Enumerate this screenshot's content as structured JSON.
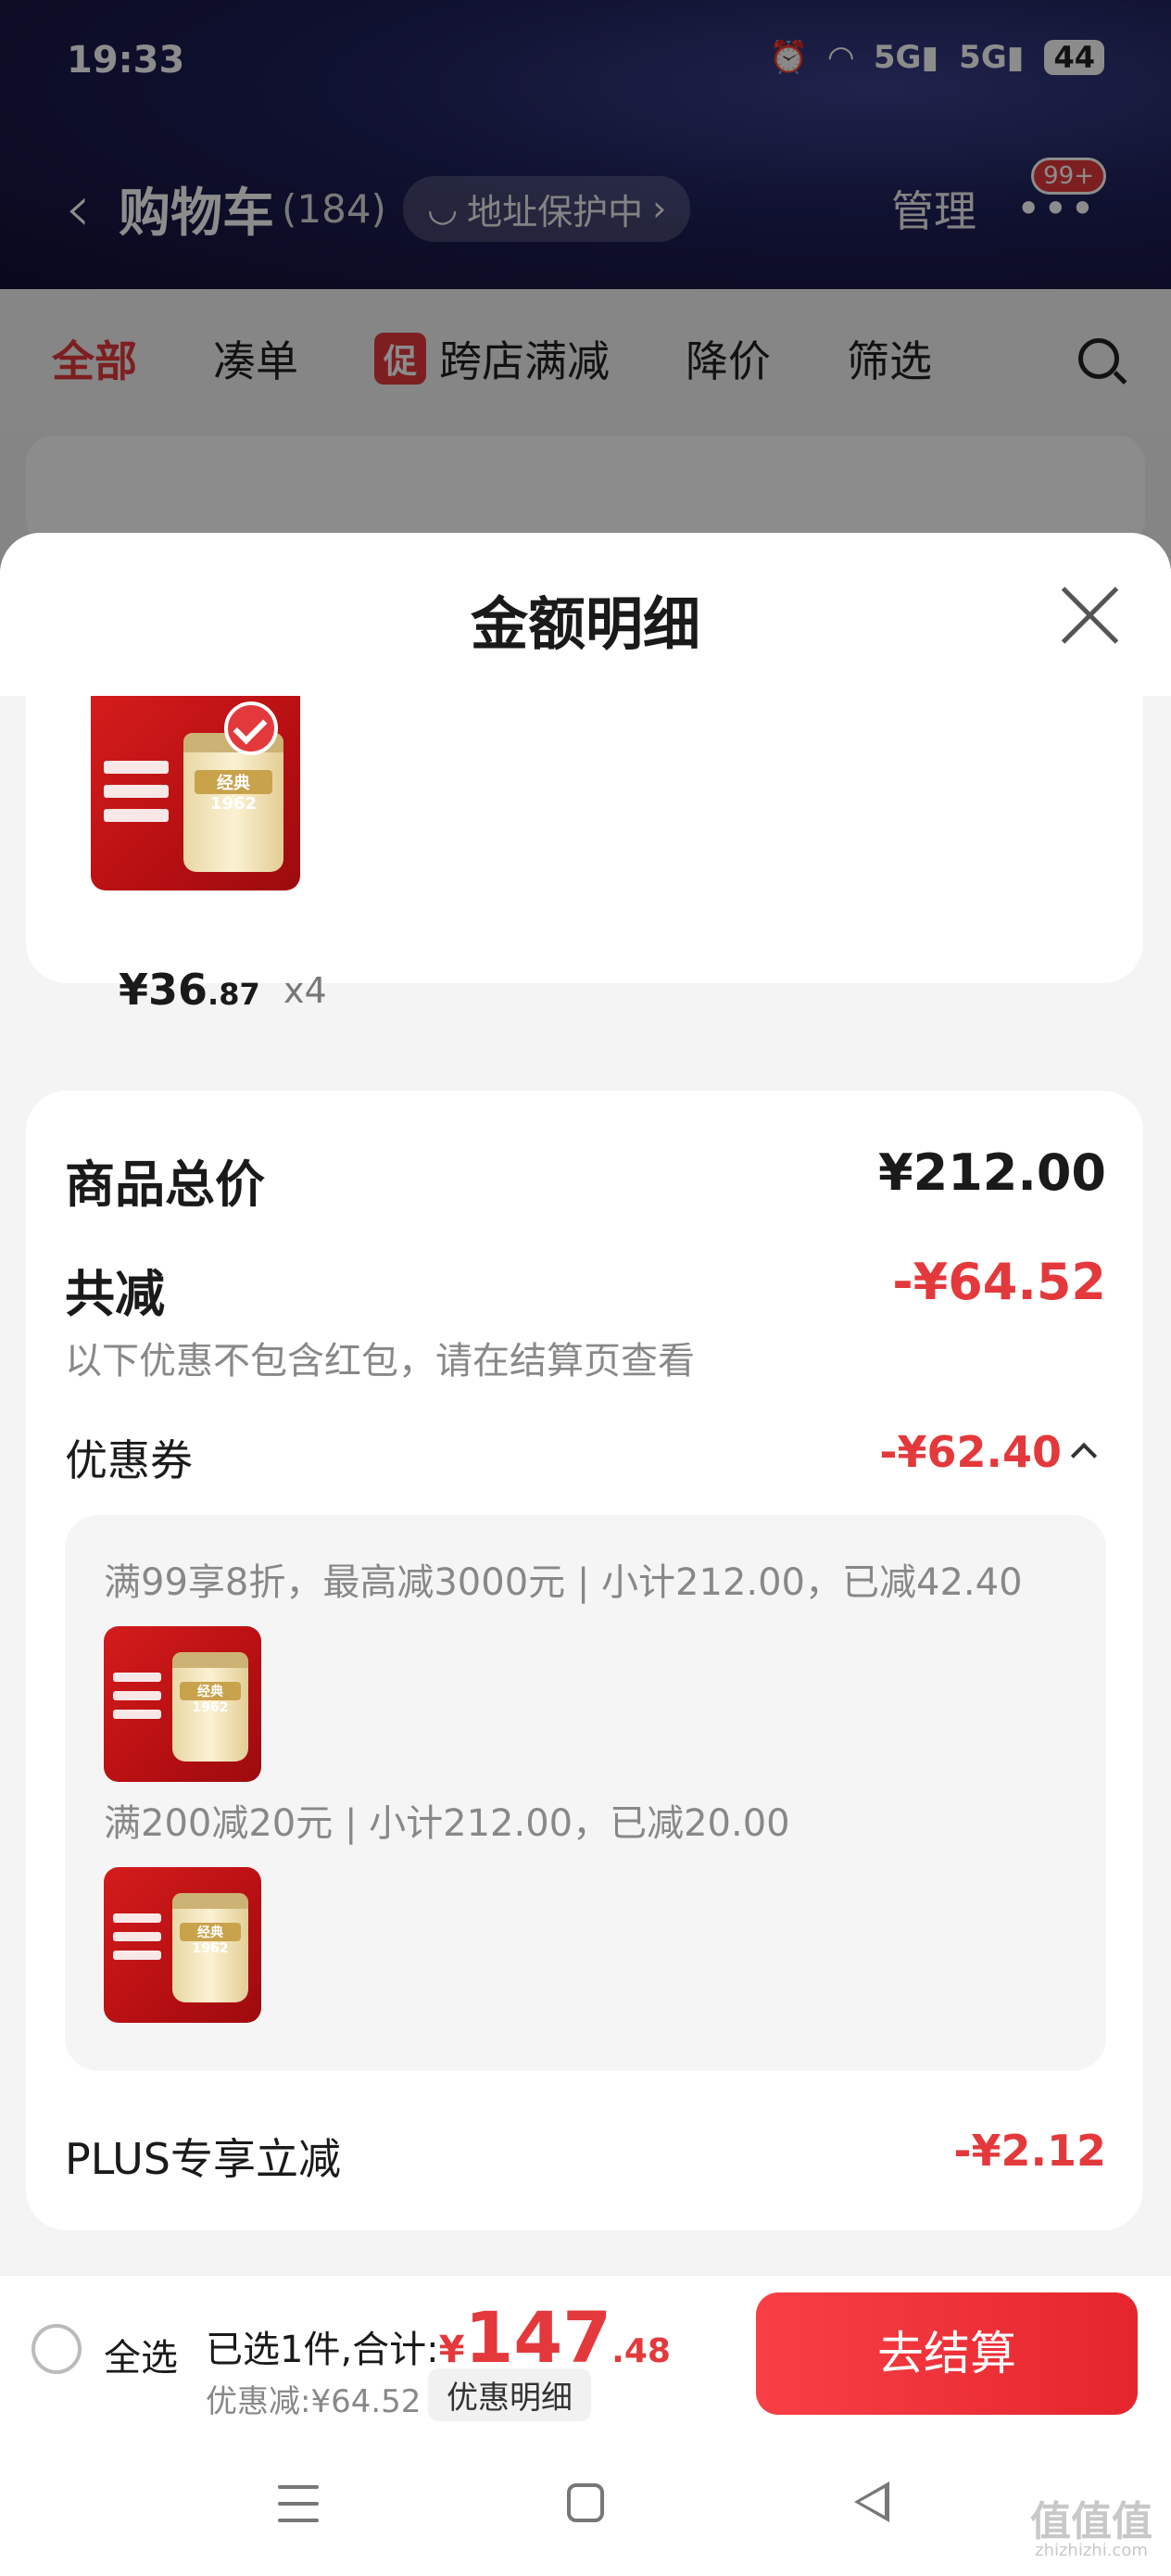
{
  "status_bar": {
    "time": "19:33",
    "net1": "5G",
    "net2": "5G",
    "battery": "44"
  },
  "header": {
    "title": "购物车",
    "count": "(184)",
    "address_protection": "地址保护中",
    "manage": "管理",
    "badge": "99+"
  },
  "filters": [
    {
      "label": "全部",
      "active": true
    },
    {
      "label": "凑单"
    },
    {
      "label": "跨店满减",
      "tag": "促"
    },
    {
      "label": "降价"
    },
    {
      "label": "筛选"
    }
  ],
  "sheet": {
    "title": "金额明细",
    "product": {
      "price_int": "¥36",
      "price_dec": ".87",
      "qty": "x4",
      "brand": "经典1962"
    },
    "total_label": "商品总价",
    "total_value": "¥212.00",
    "discount_label": "共减",
    "discount_value": "-¥64.52",
    "discount_note": "以下优惠不包含红包，请在结算页查看",
    "coupon_label": "优惠券",
    "coupon_value": "-¥62.40",
    "coupon_rules": [
      "满99享8折，最高减3000元 | 小计212.00，已减42.40",
      "满200减20元 | 小计212.00，已减20.00"
    ],
    "plus_label": "PLUS专享立减",
    "plus_value": "-¥2.12"
  },
  "bottom_bar": {
    "select_all": "全选",
    "selected_text": "已选1件,合计:",
    "total_currency": "¥",
    "total_int": "147",
    "total_dec": ".48",
    "saved_text": "优惠减:¥64.52",
    "detail_button": "优惠明细",
    "checkout_button": "去结算"
  },
  "watermark": {
    "text": "值值值",
    "sub": "zhizhizhi.com"
  },
  "colors": {
    "accent": "#e4393c",
    "header_bg": "#1d2058"
  }
}
